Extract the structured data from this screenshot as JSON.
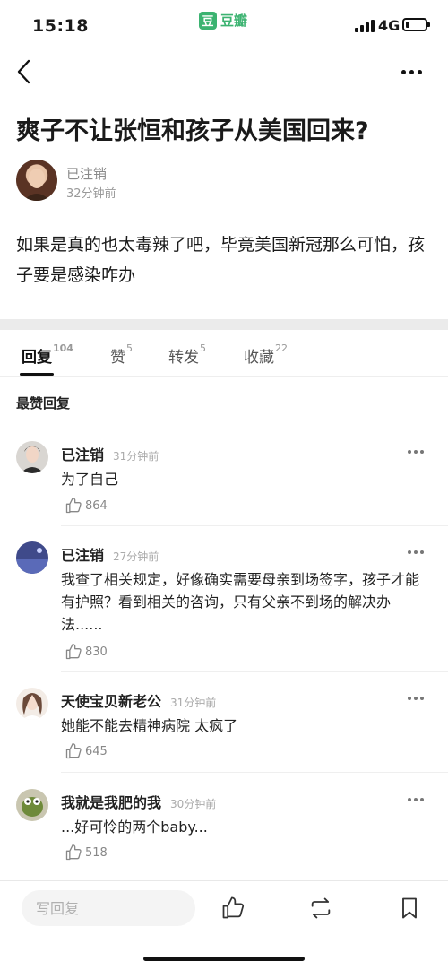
{
  "status_bar": {
    "time": "15:18",
    "app_logo": "豆",
    "app_name": "豆瓣",
    "network": "4G",
    "battery_level": 0.2
  },
  "post": {
    "title": "爽子不让张恒和孩子从美国回来?",
    "author": "已注销",
    "time": "32分钟前",
    "body": "如果是真的也太毒辣了吧，毕竟美国新冠那么可怕，孩子要是感染咋办"
  },
  "tabs": [
    {
      "label": "回复",
      "count": "104"
    },
    {
      "label": "赞",
      "count": "5"
    },
    {
      "label": "转发",
      "count": "5"
    },
    {
      "label": "收藏",
      "count": "22"
    }
  ],
  "section_label": "最赞回复",
  "comments": [
    {
      "name": "已注销",
      "time": "31分钟前",
      "text": "为了自己",
      "likes": "864"
    },
    {
      "name": "已注销",
      "time": "27分钟前",
      "text": "我查了相关规定，好像确实需要母亲到场签字，孩子才能有护照？看到相关的咨询，只有父亲不到场的解决办法......",
      "likes": "830"
    },
    {
      "name": "天使宝贝新老公",
      "time": "31分钟前",
      "text": "她能不能去精神病院 太疯了",
      "likes": "645"
    },
    {
      "name": "我就是我肥的我",
      "time": "30分钟前",
      "text": "...好可怜的两个baby...",
      "likes": "518"
    }
  ],
  "bottom_bar": {
    "reply_placeholder": "写回复"
  },
  "icons": {
    "back": "chevron-left-icon",
    "more": "more-dots-icon",
    "like": "thumbs-up-icon",
    "repost": "repost-icon",
    "bookmark": "bookmark-icon",
    "signal": "signal-icon",
    "battery": "battery-icon"
  },
  "colors": {
    "brand": "#3cb371",
    "text": "#1a1a1a",
    "muted": "#8a8a8a",
    "divider": "#ebebeb"
  }
}
